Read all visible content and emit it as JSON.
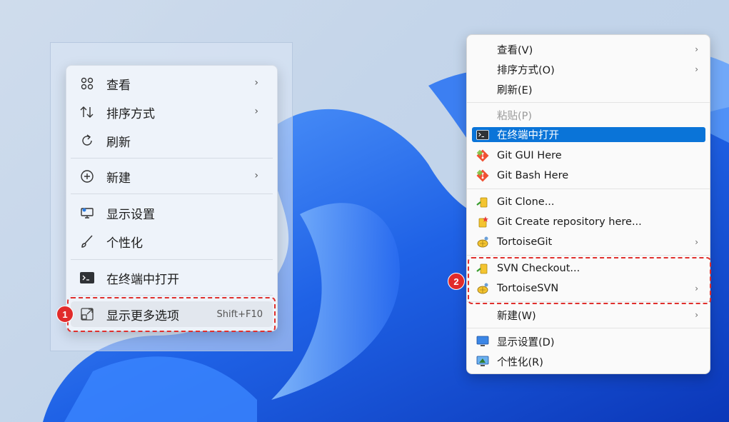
{
  "left_menu": {
    "items": [
      {
        "label": "查看",
        "icon": "view-grid-icon",
        "submenu": true
      },
      {
        "label": "排序方式",
        "icon": "sort-icon",
        "submenu": true
      },
      {
        "label": "刷新",
        "icon": "refresh-icon",
        "submenu": false
      },
      {
        "label": "新建",
        "icon": "new-plus-icon",
        "submenu": true
      },
      {
        "label": "显示设置",
        "icon": "display-settings-icon",
        "submenu": false
      },
      {
        "label": "个性化",
        "icon": "brush-icon",
        "submenu": false
      },
      {
        "label": "在终端中打开",
        "icon": "terminal-icon",
        "submenu": false
      },
      {
        "label": "显示更多选项",
        "icon": "more-options-icon",
        "shortcut": "Shift+F10",
        "highlighted": true
      }
    ],
    "badge": "1"
  },
  "right_menu": {
    "items": [
      {
        "label": "查看(V)",
        "submenu": true
      },
      {
        "label": "排序方式(O)",
        "submenu": true
      },
      {
        "label": "刷新(E)"
      },
      {
        "label": "粘贴(P)",
        "disabled": true
      },
      {
        "label": "在终端中打开",
        "icon": "terminal-icon",
        "active": true
      },
      {
        "label": "Git GUI Here",
        "icon": "git-icon"
      },
      {
        "label": "Git Bash Here",
        "icon": "git-icon"
      },
      {
        "label": "Git Clone...",
        "icon": "git-clone-icon"
      },
      {
        "label": "Git Create repository here...",
        "icon": "git-create-icon"
      },
      {
        "label": "TortoiseGit",
        "icon": "tortoise-git-icon",
        "submenu": true
      },
      {
        "label": "SVN Checkout...",
        "icon": "svn-checkout-icon"
      },
      {
        "label": "TortoiseSVN",
        "icon": "tortoise-svn-icon",
        "submenu": true
      },
      {
        "label": "新建(W)",
        "submenu": true
      },
      {
        "label": "显示设置(D)",
        "icon": "display-icon"
      },
      {
        "label": "个性化(R)",
        "icon": "personalize-icon"
      }
    ],
    "badge": "2"
  },
  "colors": {
    "accent": "#0a74d8",
    "highlight_dash": "#e0302d",
    "badge": "#e12b2b"
  },
  "chevron": "›"
}
